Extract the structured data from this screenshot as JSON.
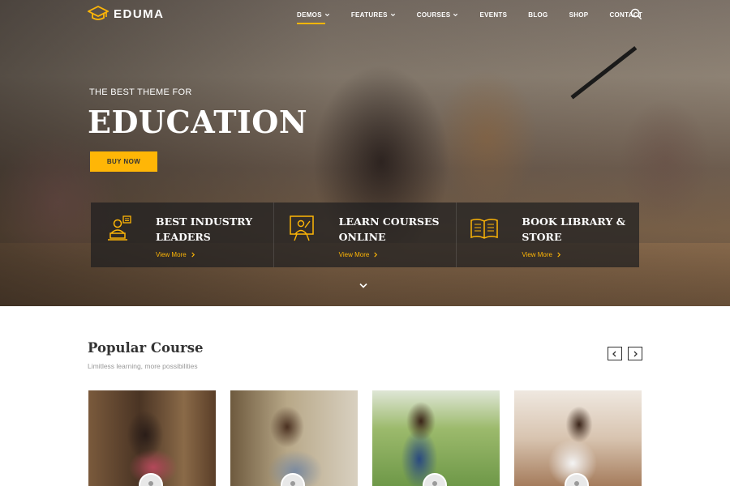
{
  "brand": {
    "name": "EDUMA",
    "accent": "#ffb606"
  },
  "nav": {
    "items": [
      {
        "label": "DEMOS",
        "dropdown": true,
        "active": true
      },
      {
        "label": "FEATURES",
        "dropdown": true,
        "active": false
      },
      {
        "label": "COURSES",
        "dropdown": true,
        "active": false
      },
      {
        "label": "EVENTS",
        "dropdown": false,
        "active": false
      },
      {
        "label": "BLOG",
        "dropdown": false,
        "active": false
      },
      {
        "label": "SHOP",
        "dropdown": false,
        "active": false
      },
      {
        "label": "CONTACT",
        "dropdown": false,
        "active": false
      }
    ],
    "search_icon": "search-icon"
  },
  "hero": {
    "subtitle": "THE BEST THEME FOR",
    "title": "EDUCATION",
    "button_label": "BUY NOW",
    "scroll_icon": "chevron-down-icon"
  },
  "features": [
    {
      "icon": "teacher-laptop-icon",
      "title": "BEST INDUSTRY LEADERS",
      "link": "View More"
    },
    {
      "icon": "presentation-board-icon",
      "title": "LEARN COURSES ONLINE",
      "link": "View More"
    },
    {
      "icon": "open-book-icon",
      "title": "BOOK LIBRARY & STORE",
      "link": "View More"
    }
  ],
  "popular": {
    "title": "Popular Course",
    "subtitle": "Limitless learning, more possibilities",
    "prev_icon": "chevron-left-icon",
    "next_icon": "chevron-right-icon"
  }
}
